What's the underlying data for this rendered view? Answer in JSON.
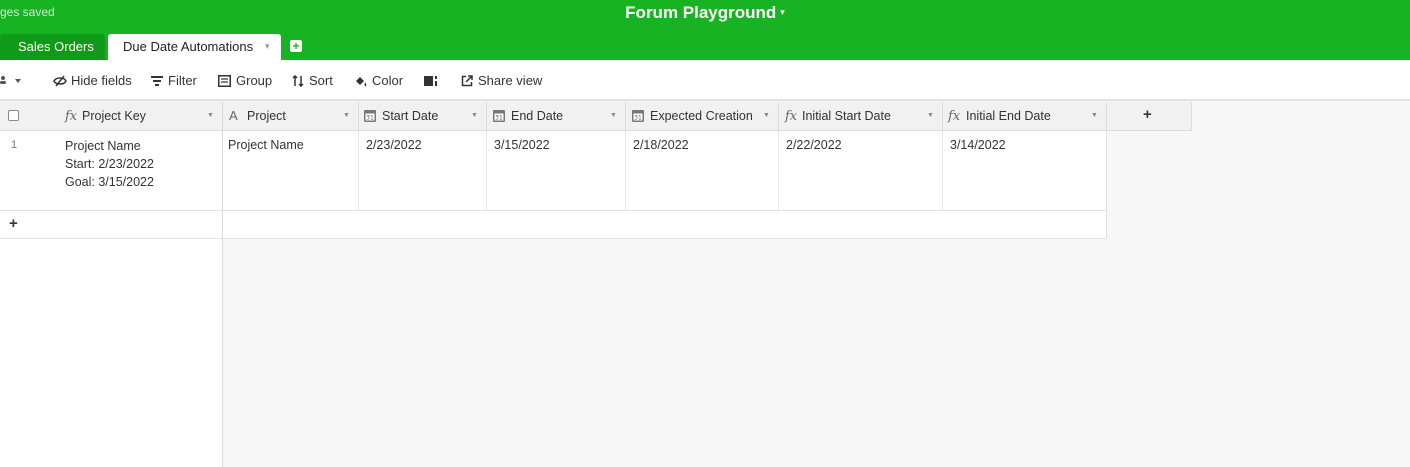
{
  "app": {
    "save_status": "ges saved",
    "title": "Forum Playground",
    "title_caret": "▾"
  },
  "tabs": [
    {
      "label": "Sales Orders",
      "active": false
    },
    {
      "label": "Due Date Automations",
      "active": true,
      "caret": "▾"
    }
  ],
  "toolbar": {
    "hide_fields": "Hide fields",
    "filter": "Filter",
    "group": "Group",
    "sort": "Sort",
    "color": "Color",
    "share_view": "Share view"
  },
  "grid": {
    "columns": [
      {
        "label": "Project Key",
        "icon": "formula-icon"
      },
      {
        "label": "Project",
        "icon": "text-icon"
      },
      {
        "label": "Start Date",
        "icon": "calendar-icon"
      },
      {
        "label": "End Date",
        "icon": "calendar-icon"
      },
      {
        "label": "Expected Creation",
        "icon": "calendar-icon"
      },
      {
        "label": "Initial Start Date",
        "icon": "formula-icon"
      },
      {
        "label": "Initial End Date",
        "icon": "formula-icon"
      }
    ],
    "rows": [
      {
        "number": "1",
        "project_key": [
          "Project Name",
          "Start: 2/23/2022",
          "Goal: 3/15/2022"
        ],
        "project": "Project Name",
        "start_date": "2/23/2022",
        "end_date": "3/15/2022",
        "expected_creation": "2/18/2022",
        "initial_start_date": "2/22/2022",
        "initial_end_date": "3/14/2022"
      }
    ],
    "add_column": "+",
    "add_row": "+"
  },
  "colors": {
    "brand_green": "#18b322",
    "tab_dark_green": "#109a19"
  }
}
